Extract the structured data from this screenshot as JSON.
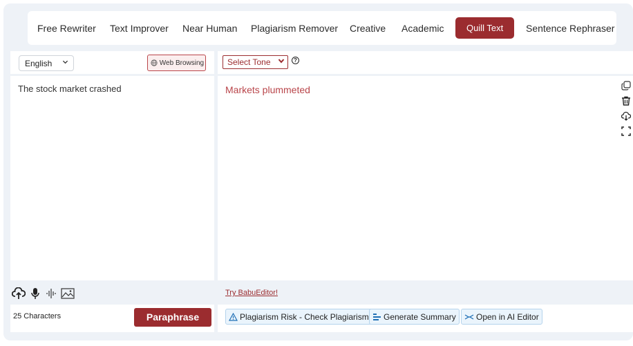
{
  "modes": [
    {
      "label": "Free Rewriter"
    },
    {
      "label": "Text Improver"
    },
    {
      "label": "Near Human"
    },
    {
      "label": "Plagiarism Remover"
    },
    {
      "label": "Creative"
    },
    {
      "label": "Academic"
    },
    {
      "label": "Quill Text",
      "active": true
    },
    {
      "label": "Sentence Rephraser"
    }
  ],
  "left": {
    "language": "English",
    "web_browsing": "Web Browsing",
    "input_text": "The stock market crashed",
    "char_count": "25 Characters",
    "paraphrase_label": "Paraphrase"
  },
  "right": {
    "tone_placeholder": "Select Tone",
    "help_glyph": "?",
    "output_text": "Markets plummeted",
    "try_link": "Try BabuEditor!",
    "plagiarism_label": "Plagiarism Risk - Check Plagiarism",
    "summary_label": "Generate Summary",
    "ai_editor_label": "Open in AI Editor"
  },
  "colors": {
    "brand": "#9b2c2f",
    "output_text": "#b9454a",
    "panel_bg": "#eef2f7",
    "chip_bg": "#eaf4fc",
    "chip_border": "#b4d3ec"
  },
  "icons": {
    "side": [
      "copy-icon",
      "trash-icon",
      "download-icon",
      "fullscreen-icon"
    ],
    "input_tools": [
      "upload-icon",
      "microphone-icon",
      "audio-wave-icon",
      "image-icon"
    ],
    "chips": [
      "warning-icon",
      "summary-icon",
      "ai-editor-icon"
    ]
  }
}
